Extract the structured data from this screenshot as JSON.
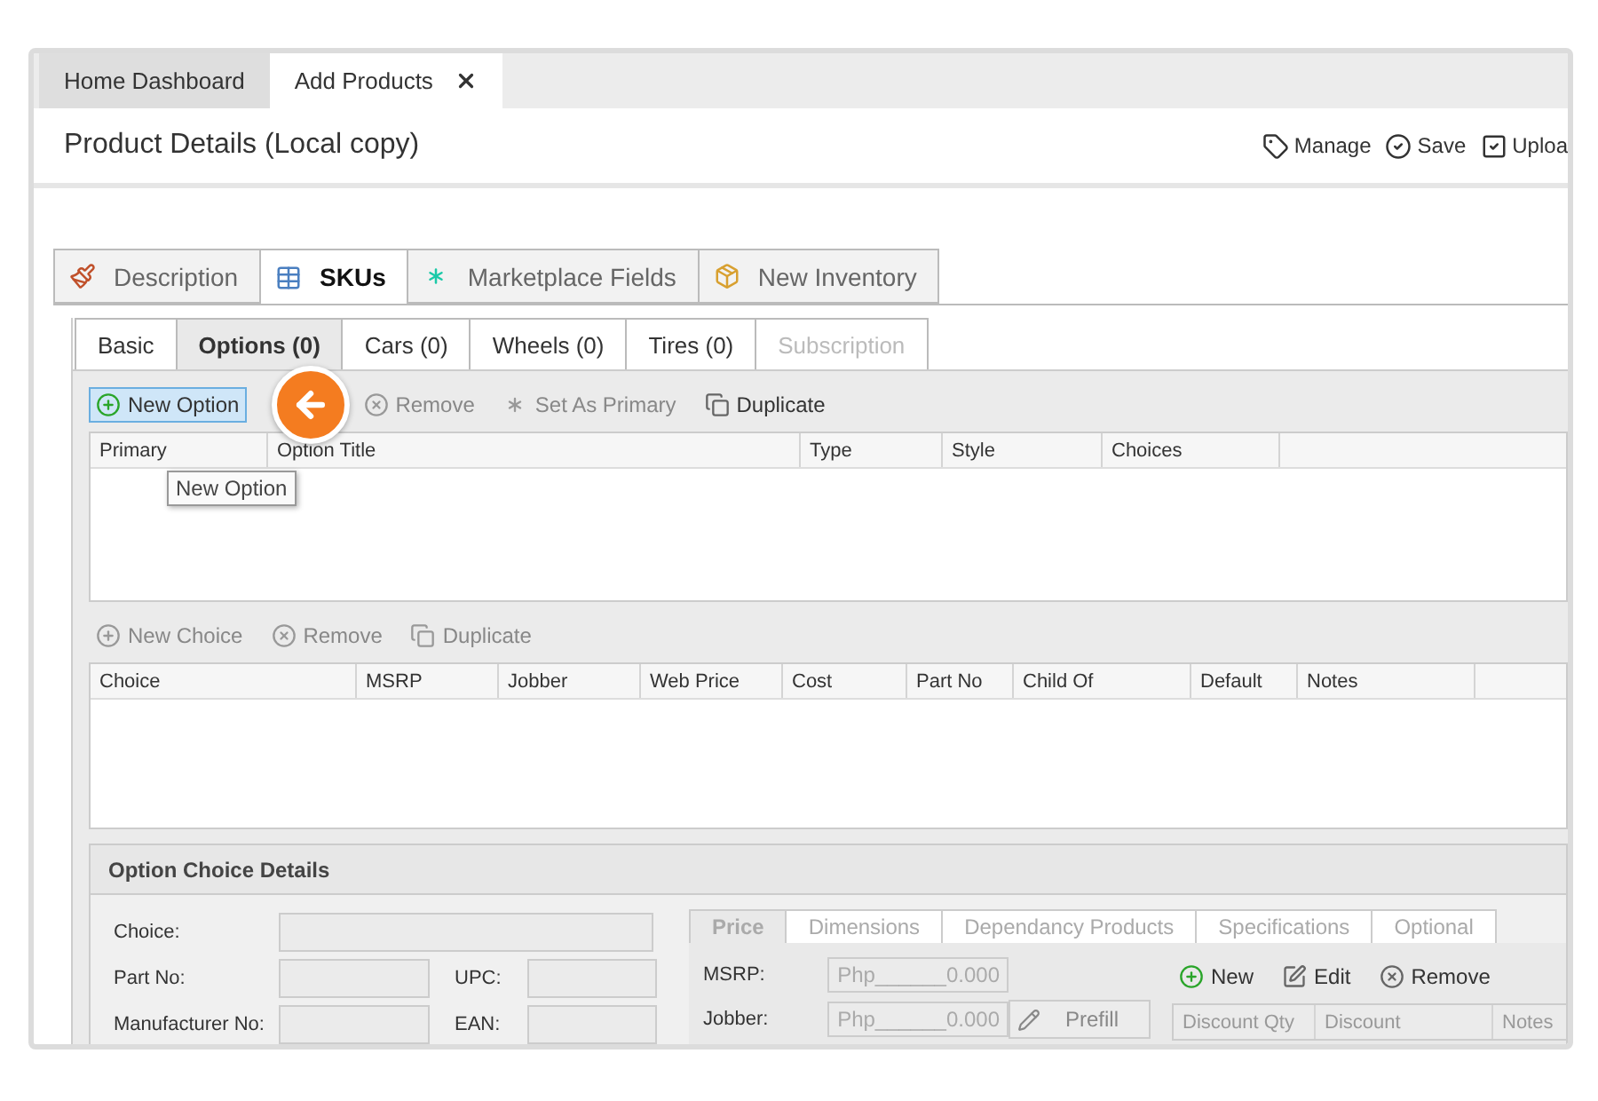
{
  "window_tabs": [
    {
      "label": "Home Dashboard",
      "selected": false,
      "closable": false
    },
    {
      "label": "Add Products",
      "selected": true,
      "closable": true
    }
  ],
  "header": {
    "title": "Product Details (Local copy)",
    "actions": [
      {
        "label": "Manage"
      },
      {
        "label": "Save"
      },
      {
        "label": "Uploa"
      }
    ]
  },
  "main_tabs": [
    {
      "label": "Description",
      "selected": false
    },
    {
      "label": "SKUs",
      "selected": true
    },
    {
      "label": "Marketplace Fields",
      "selected": false
    },
    {
      "label": "New Inventory",
      "selected": false
    }
  ],
  "sub_tabs": [
    {
      "label": "Basic",
      "selected": false,
      "disabled": false
    },
    {
      "label": "Options (0)",
      "selected": true,
      "disabled": false
    },
    {
      "label": "Cars (0)",
      "selected": false,
      "disabled": false
    },
    {
      "label": "Wheels (0)",
      "selected": false,
      "disabled": false
    },
    {
      "label": "Tires (0)",
      "selected": false,
      "disabled": false
    },
    {
      "label": "Subscription",
      "selected": false,
      "disabled": true
    }
  ],
  "option_toolbar": [
    {
      "label": "New Option",
      "kind": "add",
      "highlighted": true,
      "disabled": false
    },
    {
      "label": "Remove",
      "kind": "remove",
      "highlighted": false,
      "disabled": true
    },
    {
      "label": "Set As Primary",
      "kind": "primary",
      "highlighted": false,
      "disabled": true
    },
    {
      "label": "Duplicate",
      "kind": "duplicate",
      "highlighted": false,
      "disabled": false
    }
  ],
  "tooltip": "New Option",
  "options_table": {
    "columns": [
      "Primary",
      "Option Title",
      "Type",
      "Style",
      "Choices"
    ]
  },
  "choice_toolbar": [
    {
      "label": "New Choice",
      "kind": "add",
      "highlighted": false,
      "disabled": true
    },
    {
      "label": "Remove",
      "kind": "remove",
      "highlighted": false,
      "disabled": true
    },
    {
      "label": "Duplicate",
      "kind": "duplicate",
      "highlighted": false,
      "disabled": true
    }
  ],
  "choices_table": {
    "columns": [
      "Choice",
      "MSRP",
      "Jobber",
      "Web Price",
      "Cost",
      "Part No",
      "Child Of",
      "Default",
      "Notes"
    ]
  },
  "details": {
    "title": "Option Choice Details",
    "rows": [
      {
        "fields": [
          {
            "label": "Choice:",
            "kind": "wide"
          }
        ]
      },
      {
        "fields": [
          {
            "label": "Part No:",
            "kind": "narrow"
          },
          {
            "label": "UPC:",
            "kind": "narrow"
          }
        ]
      },
      {
        "fields": [
          {
            "label": "Manufacturer No:",
            "kind": "narrow"
          },
          {
            "label": "EAN:",
            "kind": "narrow"
          }
        ]
      }
    ],
    "price_tabs": [
      {
        "label": "Price",
        "selected": true
      },
      {
        "label": "Dimensions",
        "selected": false
      },
      {
        "label": "Dependancy Products",
        "selected": false
      },
      {
        "label": "Specifications",
        "selected": false
      },
      {
        "label": "Optional",
        "selected": false
      }
    ],
    "price_fields": [
      {
        "label": "MSRP:",
        "value": "Php______0.000"
      },
      {
        "label": "Jobber:",
        "value": "Php______0.000",
        "button": "Prefill"
      }
    ],
    "discount_toolbar": [
      {
        "label": "New",
        "kind": "add",
        "highlighted": false,
        "disabled": false
      },
      {
        "label": "Edit",
        "kind": "edit",
        "highlighted": false,
        "disabled": false
      },
      {
        "label": "Remove",
        "kind": "remove",
        "highlighted": false,
        "disabled": false
      }
    ],
    "discount_table": {
      "columns": [
        "Discount Qty",
        "Discount",
        "Notes"
      ]
    }
  }
}
